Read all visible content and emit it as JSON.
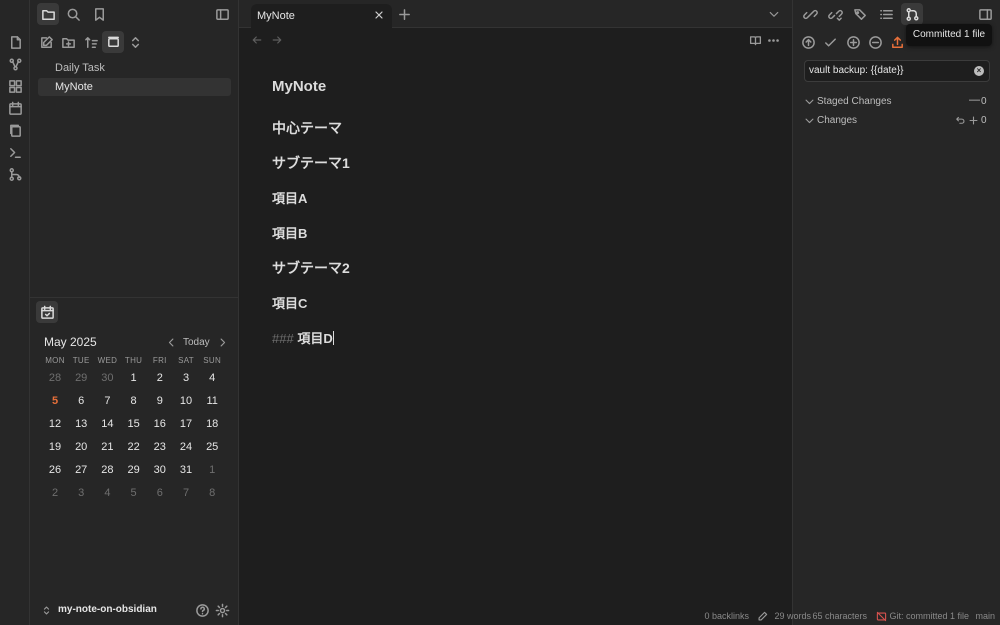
{
  "left_sidebar": {
    "files": [
      {
        "name": "Daily Task"
      },
      {
        "name": "MyNote"
      }
    ],
    "vault_name": "my-note-on-obsidian"
  },
  "calendar": {
    "month_label": "May 2025",
    "today_label": "Today",
    "weekdays": [
      "MON",
      "TUE",
      "WED",
      "THU",
      "FRI",
      "SAT",
      "SUN"
    ],
    "weeks": [
      [
        "28",
        "29",
        "30",
        "1",
        "2",
        "3",
        "4"
      ],
      [
        "5",
        "6",
        "7",
        "8",
        "9",
        "10",
        "11"
      ],
      [
        "12",
        "13",
        "14",
        "15",
        "16",
        "17",
        "18"
      ],
      [
        "19",
        "20",
        "21",
        "22",
        "23",
        "24",
        "25"
      ],
      [
        "26",
        "27",
        "28",
        "29",
        "30",
        "31",
        "1"
      ],
      [
        "2",
        "3",
        "4",
        "5",
        "6",
        "7",
        "8"
      ]
    ],
    "today_color": "#e8703a"
  },
  "tab": {
    "title": "MyNote"
  },
  "editor": {
    "title": "MyNote",
    "lines": [
      "中心テーマ",
      "サブテーマ1",
      "項目A",
      "項目B",
      "サブテーマ2",
      "項目C"
    ],
    "last_line_marker": "###",
    "last_line_text": "項目D"
  },
  "git": {
    "tooltip": "Committed 1 file",
    "commit_message": "vault backup: {{date}}",
    "staged_label": "Staged Changes",
    "staged_count": "0",
    "changes_label": "Changes",
    "changes_count": "0"
  },
  "statusbar": {
    "backlinks": "0 backlinks",
    "words": "29 words",
    "characters": "65 characters",
    "git_status": "Git: committed 1 file",
    "branch": "main"
  },
  "colors": {
    "accent": "#e8703a",
    "background": "#1e1e1e",
    "panel": "#262626"
  }
}
